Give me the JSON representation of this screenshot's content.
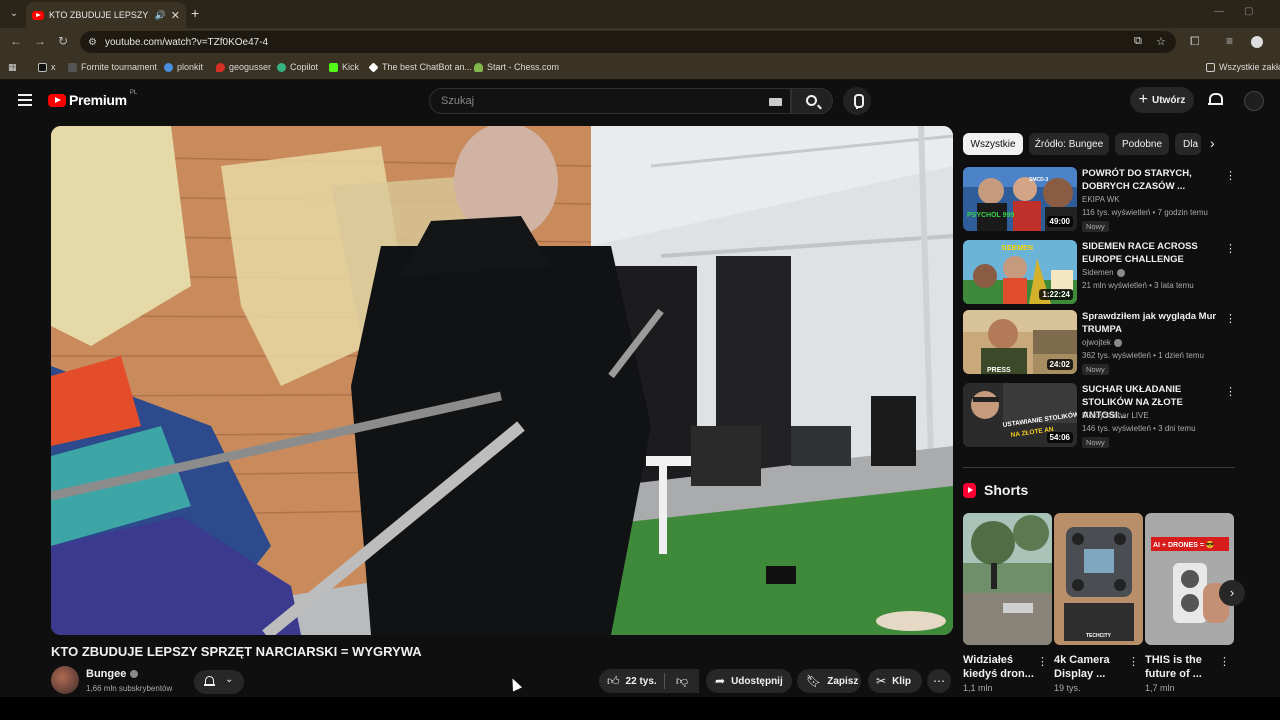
{
  "browser": {
    "tab_title": "KTO ZBUDUJE LEPSZY SPRZ",
    "url": "youtube.com/watch?v=TZf0KOe47-4",
    "bookmarks": [
      {
        "label": "x",
        "color": "#000000"
      },
      {
        "label": "Fornite tournament",
        "color": "#555555"
      },
      {
        "label": "plonkit",
        "color": "#4a90e2"
      },
      {
        "label": "geogusser",
        "color": "#d93025"
      },
      {
        "label": "Copilot",
        "color": "#36b37e"
      },
      {
        "label": "Kick",
        "color": "#53fc18"
      },
      {
        "label": "The best ChatBot an...",
        "color": "#ffffff"
      },
      {
        "label": "Start - Chess.com",
        "color": "#81b64c"
      }
    ],
    "other_bookmarks": "Wszystkie zakład"
  },
  "header": {
    "logo_text": "Premium",
    "country_code": "PL",
    "search_placeholder": "Szukaj",
    "create_label": "Utwórz"
  },
  "video": {
    "title": "KTO ZBUDUJE LEPSZY SPRZĘT NARCIARSKI = WYGRYWA",
    "channel": "Bungee",
    "subscribers": "1,66 mln subskrybentów",
    "likes": "22 tys.",
    "share_label": "Udostępnij",
    "save_label": "Zapisz",
    "clip_label": "Klip"
  },
  "chips": [
    "Wszystkie",
    "Źródło: Bungee",
    "Podobne",
    "Dla"
  ],
  "recommendations": [
    {
      "title": "POWRÓT DO STARYCH, DOBRYCH CZASÓW ...",
      "channel": "EKIPA WK",
      "verified": false,
      "meta": "116 tys. wyświetleń • 7 godzin temu",
      "badge": "Nowy",
      "duration": "49:00"
    },
    {
      "title": "SIDEMEN RACE ACROSS EUROPE CHALLENGE",
      "channel": "Sidemen",
      "verified": true,
      "meta": "21 mln wyświetleń • 3 lata temu",
      "badge": "",
      "duration": "1:22:24"
    },
    {
      "title": "Sprawdziłem jak wygląda Mur TRUMPA",
      "channel": "ojwojtek",
      "verified": true,
      "meta": "362 tys. wyświetleń • 1 dzień temu",
      "badge": "Nowy",
      "duration": "24:02"
    },
    {
      "title": "SUCHAR UKŁADANIE STOLIKÓW NA ZŁOTE ANTOSI...",
      "channel": "MokrySuchar LIVE",
      "verified": false,
      "meta": "146 tys. wyświetleń • 3 dni temu",
      "badge": "Nowy",
      "duration": "54:06"
    }
  ],
  "thumb_text": {
    "rec1_overlay": "PSYCHOL 999",
    "rec1_badge": "SMCD-3",
    "rec2_overlay": "SIDEMEN",
    "rec3_overlay": "PRESS",
    "rec4_overlay_1": "USTAWIANIE STOLIKÓW",
    "rec4_overlay_2": "NA ZŁOTE AN",
    "short2_overlay": "TECHCITY",
    "short3_overlay": "AI + DRONES = 😎"
  },
  "shorts": {
    "heading": "Shorts",
    "items": [
      {
        "title": "Widziałeś kiedyś dron...",
        "views": "1,1 mln"
      },
      {
        "title": "4k Camera Display ...",
        "views": "19 tys."
      },
      {
        "title": "THIS is the future of ...",
        "views": "1,7 mln"
      }
    ]
  }
}
